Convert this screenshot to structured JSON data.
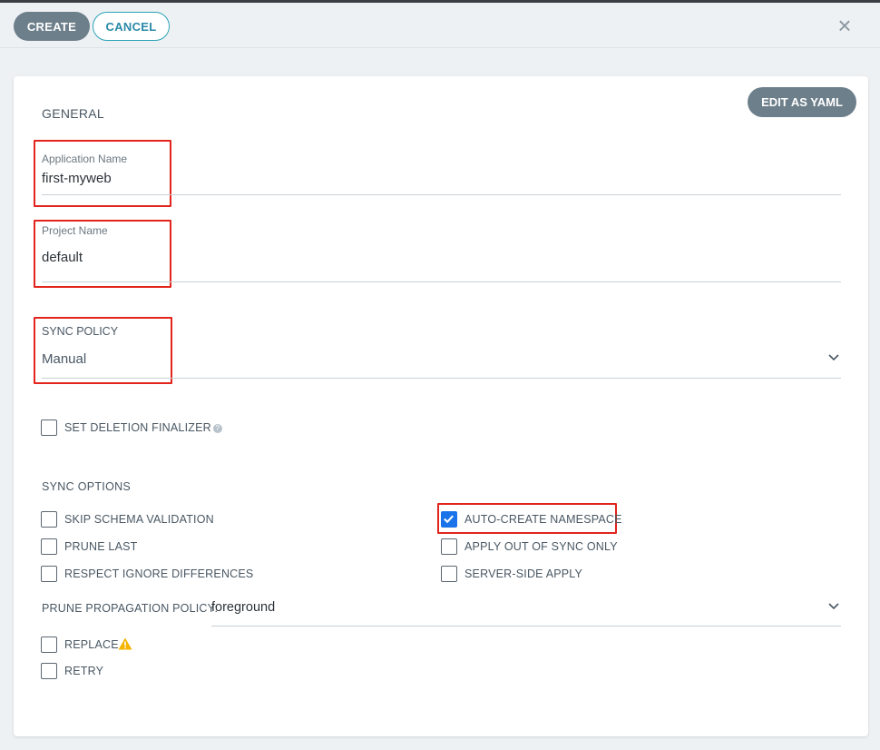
{
  "toolbar": {
    "create_label": "CREATE",
    "cancel_label": "CANCEL",
    "close_glyph": "×",
    "close_icon": "close-icon"
  },
  "card": {
    "edit_yaml_label": "EDIT AS YAML",
    "general_title": "GENERAL",
    "application_name": {
      "label": "Application Name",
      "value": "first-myweb"
    },
    "project_name": {
      "label": "Project Name",
      "value": "default"
    },
    "sync_policy": {
      "label": "SYNC POLICY",
      "value": "Manual",
      "icon": "chevron-down-icon"
    },
    "deletion_finalizer": {
      "label": "SET DELETION FINALIZER",
      "checked": false,
      "help_icon": "help-circle-icon",
      "help_glyph": "?"
    },
    "sync_options_title": "SYNC OPTIONS",
    "sync_options_left": [
      {
        "label": "SKIP SCHEMA VALIDATION",
        "checked": false
      },
      {
        "label": "PRUNE LAST",
        "checked": false
      },
      {
        "label": "RESPECT IGNORE DIFFERENCES",
        "checked": false
      }
    ],
    "sync_options_right": [
      {
        "label": "AUTO-CREATE NAMESPACE",
        "checked": true
      },
      {
        "label": "APPLY OUT OF SYNC ONLY",
        "checked": false
      },
      {
        "label": "SERVER-SIDE APPLY",
        "checked": false
      }
    ],
    "prune_propagation": {
      "label": "PRUNE PROPAGATION POLICY:",
      "value": "foreground",
      "icon": "chevron-down-icon"
    },
    "replace": {
      "label": "REPLACE",
      "checked": false,
      "warning_icon": "warning-icon"
    },
    "retry": {
      "label": "RETRY",
      "checked": false
    }
  },
  "colors": {
    "primary_button": "#6d7f8b",
    "cancel_accent": "#2aa3b6",
    "highlight_box": "#e2241d",
    "checkbox_checked": "#1a73e8",
    "warning": "#f4b400"
  }
}
